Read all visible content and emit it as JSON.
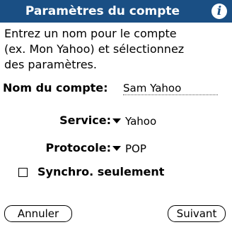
{
  "title": "Paramètres du compte",
  "info_icon": "info-icon",
  "instructions": [
    "Entrez un nom pour le compte",
    "(ex. Mon Yahoo) et sélectionnez",
    "des paramètres."
  ],
  "account_name": {
    "label": "Nom du compte:",
    "value": "Sam Yahoo"
  },
  "service": {
    "label": "Service:",
    "selected": "Yahoo"
  },
  "protocol": {
    "label": "Protocole:",
    "selected": "POP"
  },
  "sync_only": {
    "label": "Synchro. seulement",
    "checked": false
  },
  "buttons": {
    "cancel": "Annuler",
    "next": "Suivant"
  },
  "colors": {
    "titlebar": "#1a4f84",
    "background": "#ffffff"
  }
}
